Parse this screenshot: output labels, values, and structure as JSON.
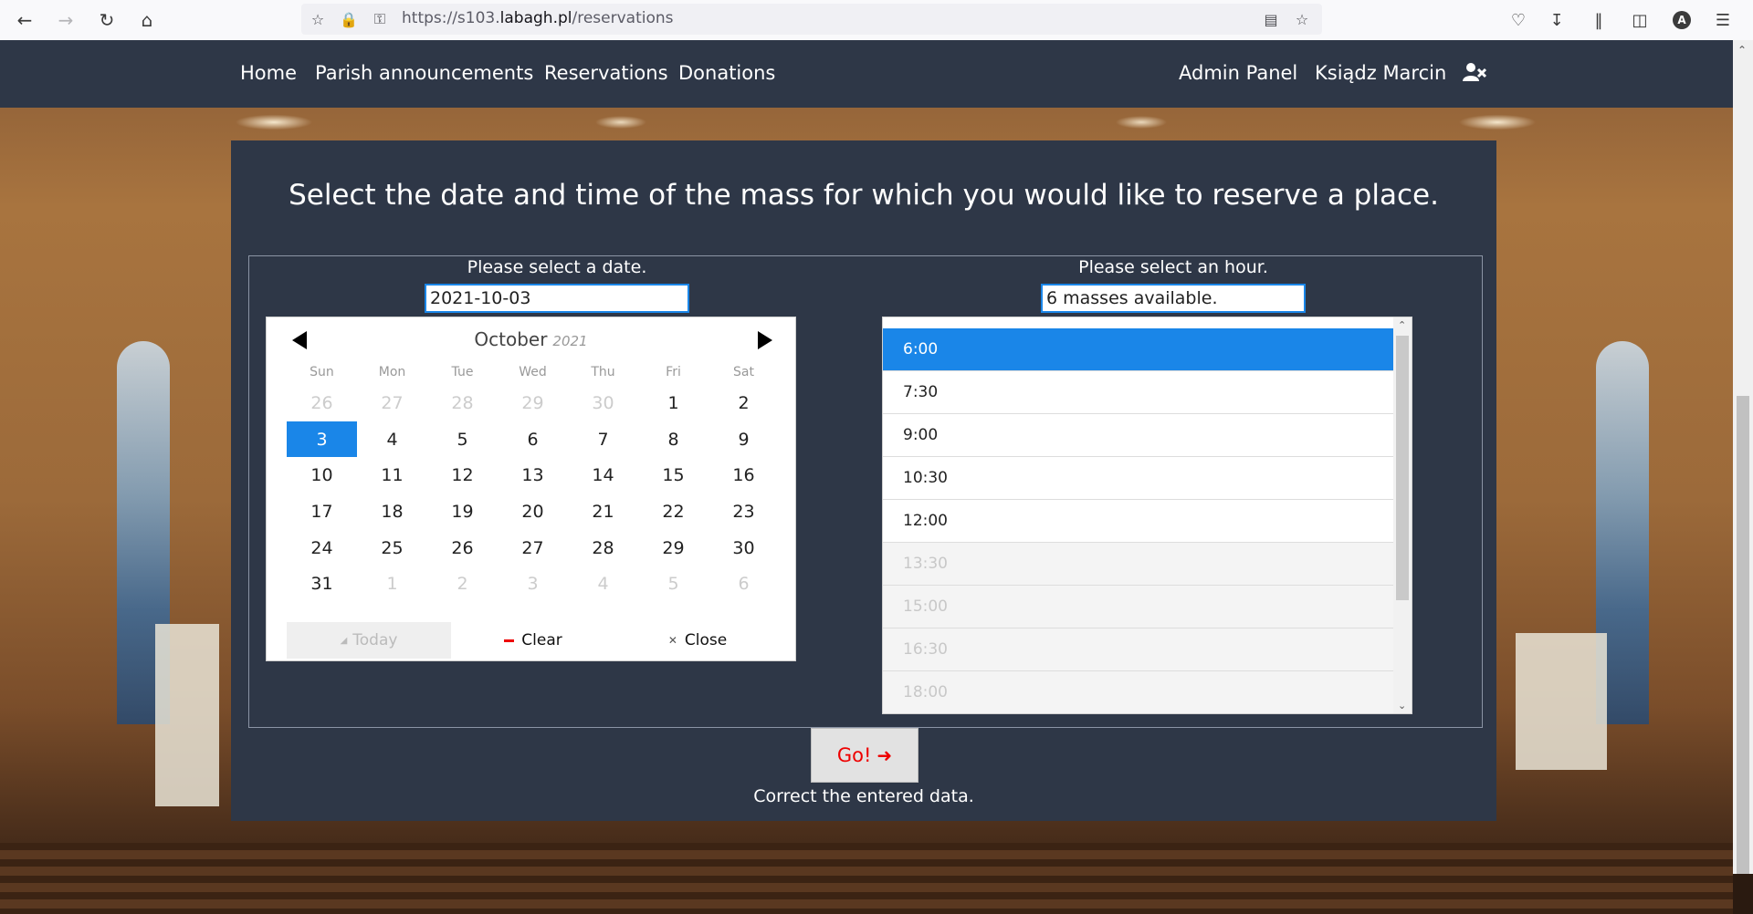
{
  "browser": {
    "url_prefix": "https://s103.",
    "url_domain": "labagh.pl",
    "url_path": "/reservations",
    "profile_initial": "A"
  },
  "nav": {
    "home": "Home",
    "announcements": "Parish announcements",
    "reservations": "Reservations",
    "donations": "Donations",
    "admin": "Admin Panel",
    "user": "Ksiądz Marcin"
  },
  "page": {
    "title": "Select the date and time of the mass for which you would like to reserve a place.",
    "date_label": "Please select a date.",
    "date_value": "2021-10-03",
    "hour_label": "Please select an hour.",
    "hour_value": "6 masses available.",
    "go_label": "Go!",
    "message": "Correct the entered data."
  },
  "calendar": {
    "month": "October",
    "year": "2021",
    "weekdays": [
      "Sun",
      "Mon",
      "Tue",
      "Wed",
      "Thu",
      "Fri",
      "Sat"
    ],
    "weeks": [
      [
        "26",
        "27",
        "28",
        "29",
        "30",
        "1",
        "2"
      ],
      [
        "3",
        "4",
        "5",
        "6",
        "7",
        "8",
        "9"
      ],
      [
        "10",
        "11",
        "12",
        "13",
        "14",
        "15",
        "16"
      ],
      [
        "17",
        "18",
        "19",
        "20",
        "21",
        "22",
        "23"
      ],
      [
        "24",
        "25",
        "26",
        "27",
        "28",
        "29",
        "30"
      ],
      [
        "31",
        "1",
        "2",
        "3",
        "4",
        "5",
        "6"
      ]
    ],
    "selected": "3",
    "today_label": "Today",
    "clear_label": "Clear",
    "close_label": "Close"
  },
  "hours": [
    {
      "time": "6:00",
      "state": "selected"
    },
    {
      "time": "7:30",
      "state": "available"
    },
    {
      "time": "9:00",
      "state": "available"
    },
    {
      "time": "10:30",
      "state": "available"
    },
    {
      "time": "12:00",
      "state": "available"
    },
    {
      "time": "13:30",
      "state": "disabled"
    },
    {
      "time": "15:00",
      "state": "disabled"
    },
    {
      "time": "16:30",
      "state": "disabled"
    },
    {
      "time": "18:00",
      "state": "disabled"
    }
  ],
  "colors": {
    "navbar": "#2e3747",
    "accent": "#1a86e8",
    "go_text": "#ee0000"
  }
}
